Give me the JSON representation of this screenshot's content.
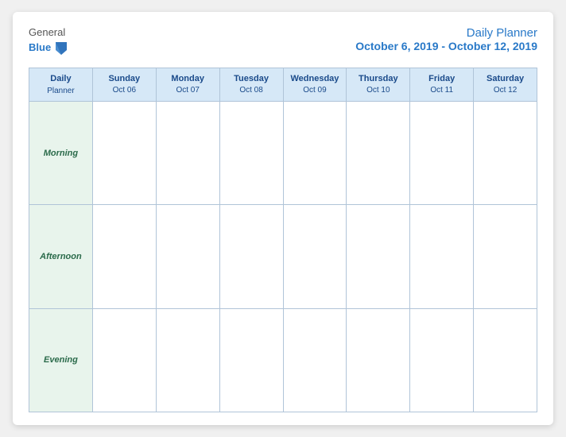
{
  "logo": {
    "general": "General",
    "blue": "Blue"
  },
  "title": {
    "main": "Daily Planner",
    "date_range": "October 6, 2019 - October 12, 2019"
  },
  "header_row": {
    "col0": {
      "line1": "Daily",
      "line2": "Planner"
    },
    "col1": {
      "day": "Sunday",
      "date": "Oct 06"
    },
    "col2": {
      "day": "Monday",
      "date": "Oct 07"
    },
    "col3": {
      "day": "Tuesday",
      "date": "Oct 08"
    },
    "col4": {
      "day": "Wednesday",
      "date": "Oct 09"
    },
    "col5": {
      "day": "Thursday",
      "date": "Oct 10"
    },
    "col6": {
      "day": "Friday",
      "date": "Oct 11"
    },
    "col7": {
      "day": "Saturday",
      "date": "Oct 12"
    }
  },
  "rows": [
    {
      "label": "Morning"
    },
    {
      "label": "Afternoon"
    },
    {
      "label": "Evening"
    }
  ]
}
